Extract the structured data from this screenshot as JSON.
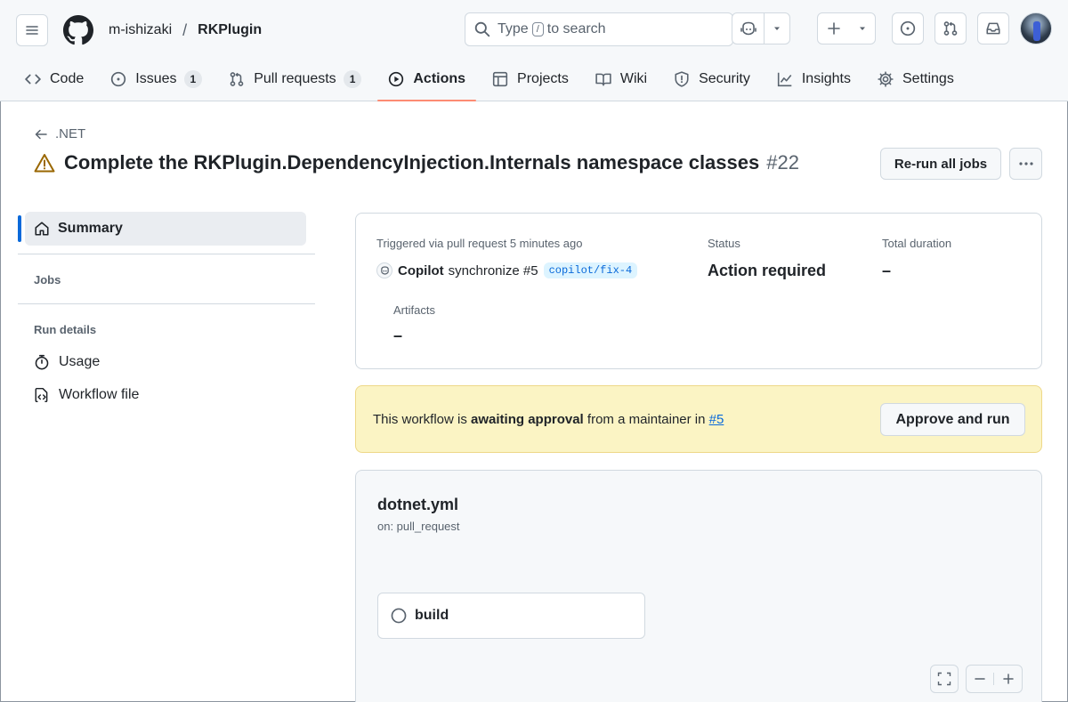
{
  "header": {
    "owner": "m-ishizaki",
    "separator": "/",
    "repo": "RKPlugin",
    "search": {
      "prefix": "Type",
      "key": "/",
      "suffix": "to search"
    }
  },
  "tabs": [
    {
      "label": "Code",
      "icon": "code-icon"
    },
    {
      "label": "Issues",
      "icon": "issue-opened-icon",
      "count": "1"
    },
    {
      "label": "Pull requests",
      "icon": "git-pull-request-icon",
      "count": "1"
    },
    {
      "label": "Actions",
      "icon": "play-icon",
      "active": true
    },
    {
      "label": "Projects",
      "icon": "table-icon"
    },
    {
      "label": "Wiki",
      "icon": "book-icon"
    },
    {
      "label": "Security",
      "icon": "shield-icon"
    },
    {
      "label": "Insights",
      "icon": "graph-icon"
    },
    {
      "label": "Settings",
      "icon": "gear-icon"
    }
  ],
  "run": {
    "back_label": ".NET",
    "title": "Complete the RKPlugin.DependencyInjection.Internals namespace classes",
    "number": "#22",
    "rerun_label": "Re-run all jobs",
    "status_icon": "alert-icon"
  },
  "sidebar": {
    "summary_label": "Summary",
    "jobs_heading": "Jobs",
    "run_details_heading": "Run details",
    "items": [
      {
        "label": "Usage",
        "icon": "stopwatch-icon"
      },
      {
        "label": "Workflow file",
        "icon": "file-code-icon"
      }
    ]
  },
  "summary": {
    "triggered_label": "Triggered via pull request 5 minutes ago",
    "actor": "Copilot",
    "event": "synchronize #5",
    "branch": "copilot/fix-4",
    "status_label": "Status",
    "status_value": "Action required",
    "duration_label": "Total duration",
    "duration_value": "–",
    "artifacts_label": "Artifacts",
    "artifacts_value": "–"
  },
  "banner": {
    "text_before": "This workflow is",
    "text_bold": "awaiting approval",
    "text_after": "from a maintainer in",
    "link": "#5",
    "approve_label": "Approve and run"
  },
  "graph": {
    "workflow_name": "dotnet.yml",
    "trigger": "on: pull_request",
    "job_name": "build"
  },
  "colors": {
    "accent": "#0969da",
    "tab_underline": "#fd8c73",
    "warning": "#9a6700",
    "banner_bg": "#fbf4c4"
  }
}
